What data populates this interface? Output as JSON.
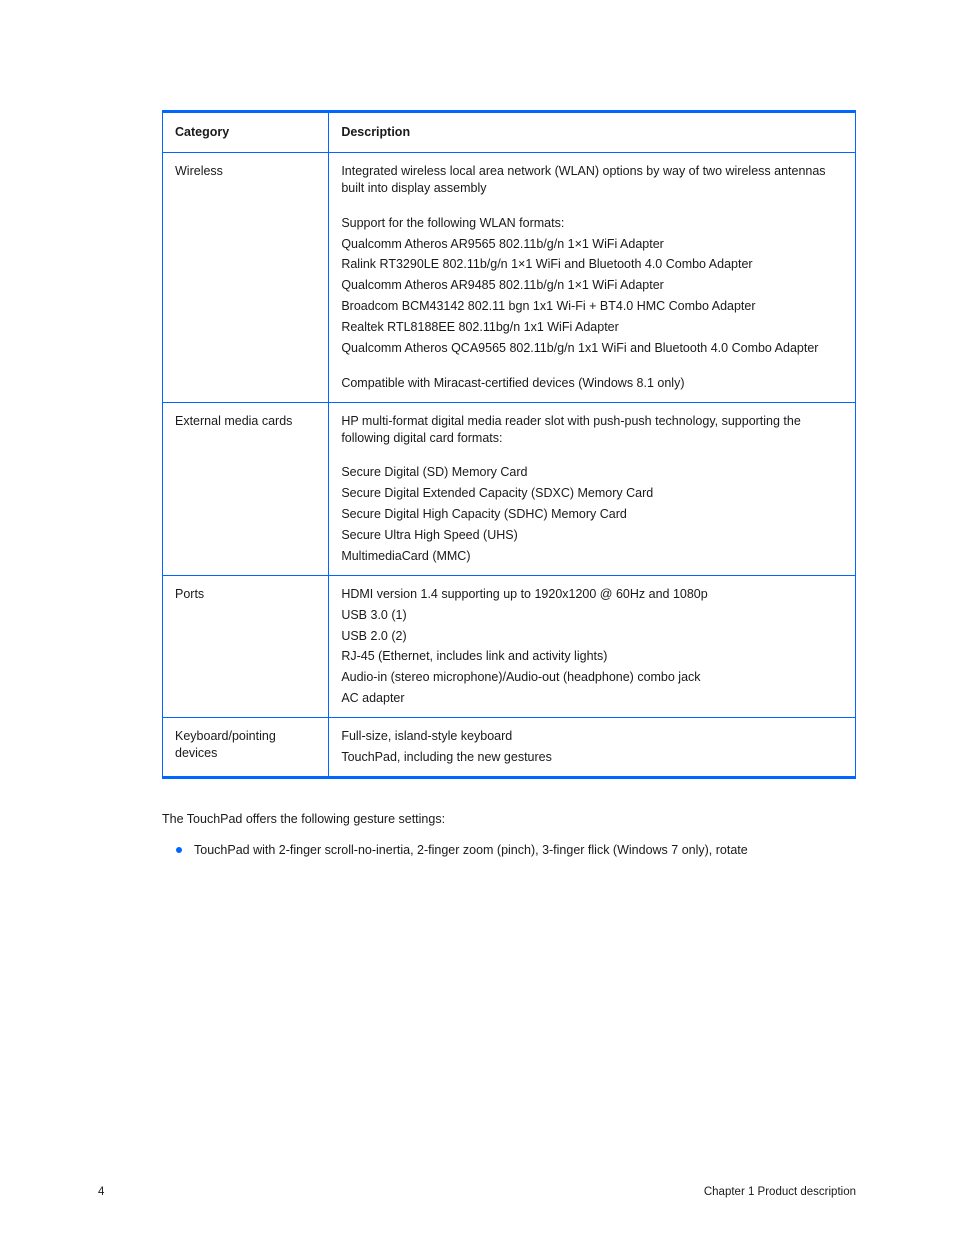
{
  "table": {
    "headers": {
      "c1": "Category",
      "c2": "Description"
    },
    "rows": [
      {
        "name": "wireless-row",
        "left_title": "Wireless",
        "left_lines": [],
        "right": {
          "groups": [
            {
              "heading": "Integrated wireless local area network (WLAN) options by way of two wireless antennas built into display assembly",
              "heading_bold": false,
              "lines": []
            },
            {
              "heading": "Support for the following WLAN formats:",
              "heading_bold": true,
              "lines": [
                "Qualcomm Atheros AR9565 802.11b/g/n 1×1 WiFi Adapter",
                "Ralink RT3290LE 802.11b/g/n 1×1 WiFi and Bluetooth 4.0 Combo Adapter",
                "Qualcomm Atheros AR9485 802.11b/g/n 1×1 WiFi Adapter",
                "Broadcom BCM43142 802.11 bgn 1x1 Wi-Fi + BT4.0 HMC Combo Adapter",
                "Realtek RTL8188EE 802.11bg/n 1x1 WiFi Adapter",
                "Qualcomm Atheros QCA9565 802.11b/g/n 1x1 WiFi and Bluetooth 4.0 Combo Adapter"
              ]
            },
            {
              "heading": "Compatible with Miracast-certified devices (Windows 8.1 only)",
              "heading_bold": false,
              "lines": []
            }
          ]
        }
      },
      {
        "name": "external-media-row",
        "left_title": "External media cards",
        "left_lines": [],
        "right": {
          "groups": [
            {
              "heading": "HP multi-format digital media reader slot with push-push technology, supporting the following digital card formats:",
              "heading_bold": false,
              "lines": [
                "Secure Digital (SD) Memory Card",
                "Secure Digital Extended Capacity (SDXC) Memory Card",
                "Secure Digital High Capacity (SDHC) Memory Card",
                "Secure Ultra High Speed (UHS)",
                "MultimediaCard (MMC)"
              ]
            }
          ]
        }
      },
      {
        "name": "ports-row",
        "left_title": "Ports",
        "left_lines": [],
        "right": {
          "groups": [
            {
              "heading": "",
              "heading_bold": false,
              "lines": [
                "HDMI version 1.4 supporting up to 1920x1200 @ 60Hz and 1080p",
                "USB 3.0 (1)",
                "USB 2.0 (2)",
                "RJ-45 (Ethernet, includes link and activity lights)",
                "Audio-in (stereo microphone)/Audio-out (headphone) combo jack",
                "AC adapter"
              ]
            }
          ]
        }
      },
      {
        "name": "keyboard-row",
        "left_title": "Keyboard/pointing devices",
        "left_lines": [],
        "right": {
          "groups": [
            {
              "heading": "",
              "heading_bold": false,
              "lines": [
                "Full-size, island-style keyboard",
                "TouchPad, including the new gestures"
              ]
            }
          ]
        }
      }
    ]
  },
  "below": {
    "lead": "The TouchPad offers the following gesture settings:",
    "bullet": "TouchPad with 2-finger scroll-no-inertia, 2-finger zoom (pinch), 3-finger flick (Windows 7 only), rotate"
  },
  "footer": {
    "left": "4",
    "right": "Chapter 1   Product description"
  }
}
